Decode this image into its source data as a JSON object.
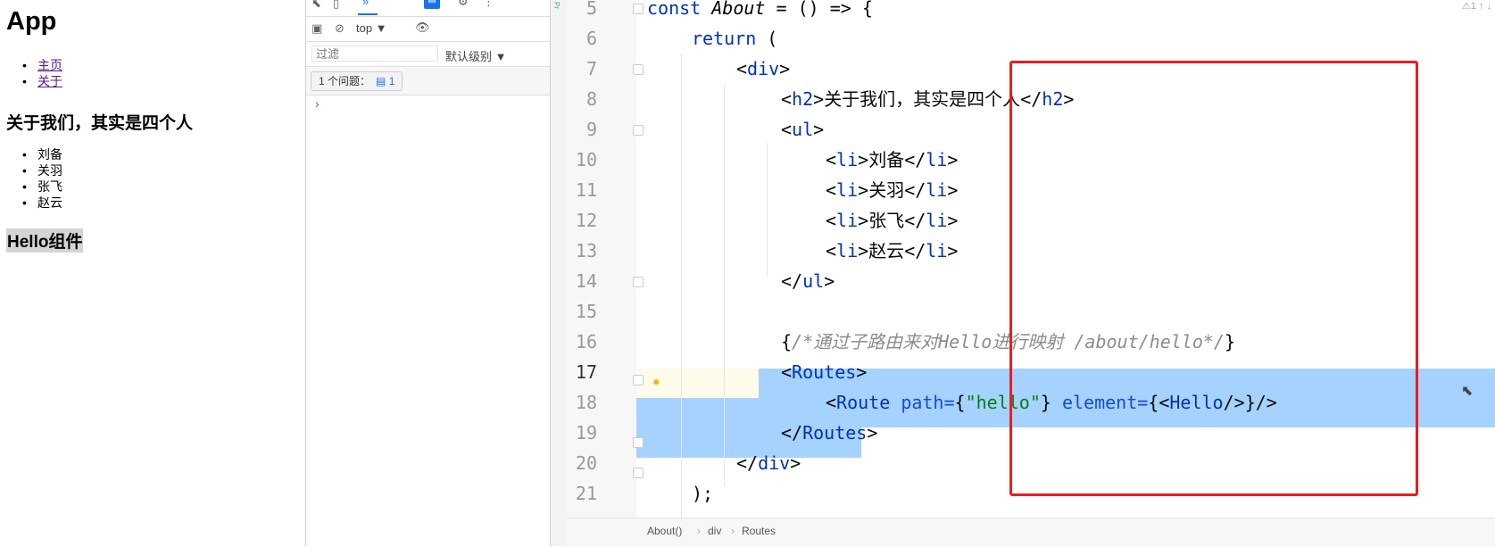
{
  "browser": {
    "app_title": "App",
    "nav": [
      "主页",
      "关于"
    ],
    "about_title": "关于我们，其实是四个人",
    "members": [
      "刘备",
      "关羽",
      "张飞",
      "赵云"
    ],
    "hello_title": "Hello组件"
  },
  "devtools": {
    "context_select": "top ▼",
    "filter_placeholder": "过滤",
    "level_select": "默认级别 ▼",
    "issues_label": "1 个问题：",
    "issues_count": "1",
    "prompt": "›"
  },
  "editor": {
    "line_numbers": [
      "5",
      "6",
      "7",
      "8",
      "9",
      "10",
      "11",
      "12",
      "13",
      "14",
      "15",
      "16",
      "17",
      "18",
      "19",
      "20",
      "21"
    ],
    "current_line": "17",
    "code": {
      "l5_kw": "const",
      "l5_name": "About",
      "l5_rest": " = () => {",
      "l6_kw": "return",
      "l6_rest": " (",
      "l7_tag": "div",
      "l8_tag": "h2",
      "l8_text": "关于我们，其实是四个人",
      "l9_tag": "ul",
      "li_tag": "li",
      "l10_text": "刘备",
      "l11_text": "关羽",
      "l12_text": "张飞",
      "l13_text": "赵云",
      "l14_tag": "ul",
      "l16_comment": "/*通过子路由来对Hello进行映射 /about/hello*/",
      "l17_tag": "Routes",
      "l18_tag": "Route",
      "l18_attr_path": "path=",
      "l18_path_value": "\"hello\"",
      "l18_attr_element": "element=",
      "l18_component": "Hello",
      "l19_tag": "Routes",
      "l20_tag": "div",
      "l21_text": ");"
    },
    "breadcrumb": [
      "About()",
      "div",
      "Routes"
    ],
    "inspection_widget": "⚠1 ↑ ↓"
  },
  "colors": {
    "keyword": "#0033b3",
    "string": "#067d17",
    "comment": "#8c8c8c",
    "selection": "#a6d2ff",
    "annotation_box": "#ee1c1c"
  }
}
